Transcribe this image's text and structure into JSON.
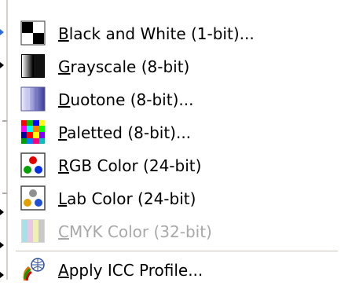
{
  "menu": {
    "items": [
      {
        "label": "Black and White (1-bit)...",
        "mnemonic": "B",
        "rest": "lack and White (1-bit)...",
        "icon": "black-white-icon",
        "disabled": false
      },
      {
        "label": "Grayscale (8-bit)",
        "mnemonic": "G",
        "rest": "rayscale (8-bit)",
        "icon": "grayscale-icon",
        "disabled": false
      },
      {
        "label": "Duotone (8-bit)...",
        "mnemonic": "D",
        "rest": "uotone (8-bit)...",
        "icon": "duotone-icon",
        "disabled": false
      },
      {
        "label": "Paletted (8-bit)...",
        "mnemonic": "P",
        "rest": "aletted (8-bit)...",
        "icon": "paletted-icon",
        "disabled": false
      },
      {
        "label": "RGB Color (24-bit)",
        "mnemonic": "R",
        "rest": "GB Color (24-bit)",
        "icon": "rgb-color-icon",
        "disabled": false
      },
      {
        "label": "Lab Color (24-bit)",
        "mnemonic": "L",
        "rest": "ab Color (24-bit)",
        "icon": "lab-color-icon",
        "disabled": false
      },
      {
        "label": "CMYK Color (32-bit)",
        "mnemonic": "C",
        "rest": "MYK Color (32-bit)",
        "icon": "cmyk-color-icon",
        "disabled": true
      },
      {
        "label": "Apply ICC Profile...",
        "mnemonic": "A",
        "rest": "pply ICC Profile...",
        "icon": "icc-profile-icon",
        "disabled": false
      }
    ]
  },
  "colors": {
    "disabled_text": "#a8a8a8",
    "separator": "#c8c4bc",
    "edge_accent": "#2f6bd8"
  }
}
